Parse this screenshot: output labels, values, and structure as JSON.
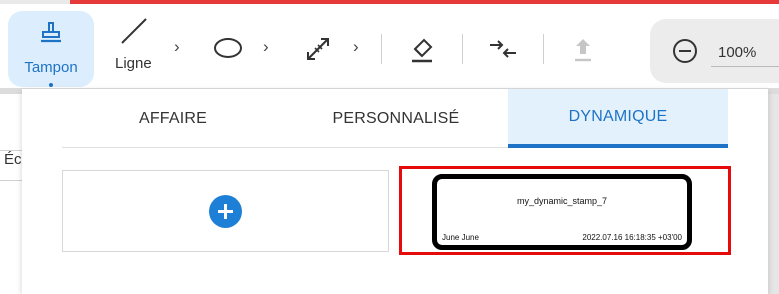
{
  "toolbar": {
    "stamp_label": "Tampon",
    "line_label": "Ligne",
    "zoom_value": "100%",
    "icons": [
      "stamp-icon",
      "line-icon",
      "ellipse-icon",
      "measure-icon",
      "eraser-icon",
      "crop-arrows-icon",
      "upload-icon",
      "zoom-out-icon"
    ]
  },
  "sidebar": {
    "partial_letter": "Éc"
  },
  "panel": {
    "tabs": [
      {
        "label": "AFFAIRE",
        "active": false
      },
      {
        "label": "PERSONNALISÉ",
        "active": false
      },
      {
        "label": "DYNAMIQUE",
        "active": true
      }
    ],
    "stamp": {
      "name": "my_dynamic_stamp_7",
      "author": "June June",
      "date": "2022.07.16 16:18:35 +03'00"
    }
  },
  "colors": {
    "accent": "#1e73c6",
    "active_tab_bg": "#e3f1fc",
    "selection_border": "#e50b0b",
    "top_bar": "#e63a3a"
  }
}
